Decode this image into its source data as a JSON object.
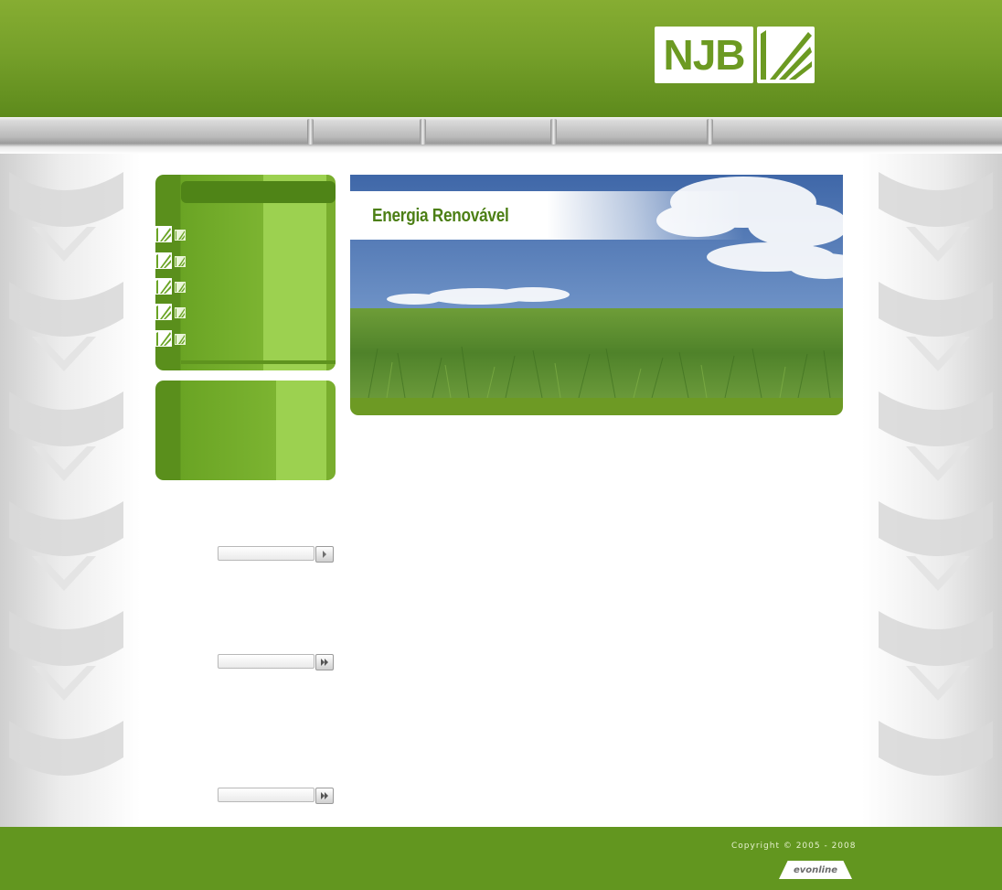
{
  "header": {
    "logo_text": "NJB",
    "logo_mark_icon": "njb-rays-icon",
    "brand_color": "#6c9a22"
  },
  "nav": {
    "items": [
      "",
      "",
      "",
      "",
      ""
    ]
  },
  "sidebar": {
    "menu_items": [
      {
        "label": "",
        "icon": "njb-rays-icon"
      },
      {
        "label": "",
        "icon": "njb-rays-icon"
      },
      {
        "label": "",
        "icon": "njb-rays-icon"
      },
      {
        "label": "",
        "icon": "njb-rays-icon"
      },
      {
        "label": "",
        "icon": "njb-rays-icon"
      }
    ],
    "forms": [
      {
        "value": "",
        "button_icon": "arrow-right-icon"
      },
      {
        "value": "",
        "button_icon": "double-arrow-right-icon"
      },
      {
        "value": "",
        "button_icon": "double-arrow-right-icon"
      }
    ]
  },
  "banner": {
    "title": "Energia Renovável"
  },
  "footer": {
    "copyright": "Copyright © 2005 - 2008",
    "credit": "evonline"
  },
  "colors": {
    "header_green": "#76a02a",
    "footer_green": "#62961f",
    "panel_green": "#7cb431",
    "title_green": "#4c7f15"
  }
}
